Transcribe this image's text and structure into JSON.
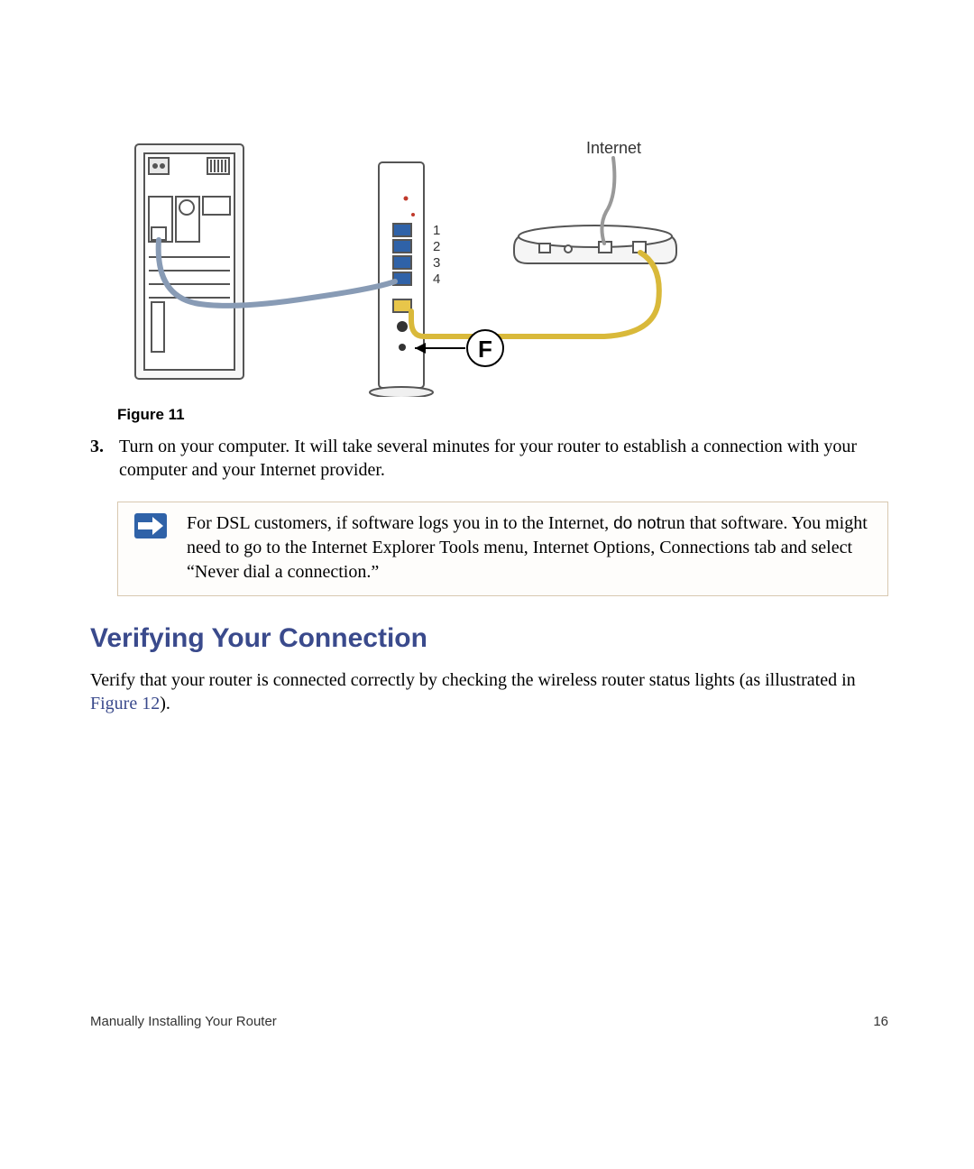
{
  "diagram": {
    "internet_label": "Internet",
    "port_labels": [
      "1",
      "2",
      "3",
      "4"
    ],
    "callout_letter": "F"
  },
  "figure_caption": "Figure 11",
  "step": {
    "number": "3.",
    "text": "Turn on your computer. It will take several minutes for your router to establish a connection with your computer and your Internet provider."
  },
  "note": {
    "pre": "For DSL customers, if software logs you in to the Internet, ",
    "emph": "do not",
    "post": "run that software. You might need to go to the Internet Explorer Tools menu, Internet Options, Connections tab and select “Never dial a connection.”"
  },
  "section_heading": "Verifying Your Connection",
  "body": {
    "pre": "Verify that your router is connected correctly by checking the wireless router status lights (as illustrated in ",
    "link": "Figure 12",
    "post": ")."
  },
  "footer": {
    "left": "Manually Installing Your Router",
    "right": "16"
  }
}
